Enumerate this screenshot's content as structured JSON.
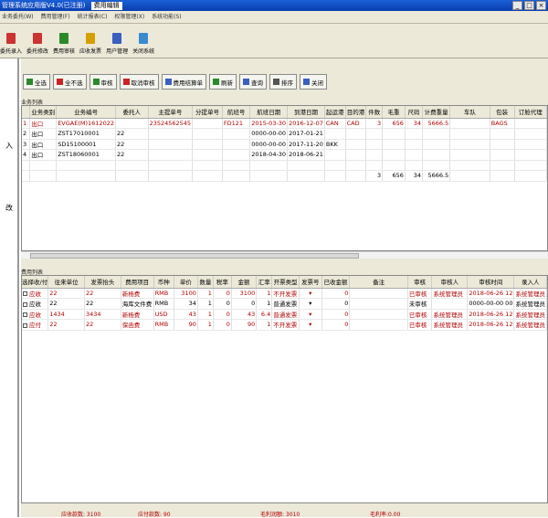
{
  "window": {
    "title": "管理系统应用版V4.0(已注册)",
    "active_tab": "费用编辑",
    "min": "_",
    "max": "□",
    "close": "×"
  },
  "menu": [
    "业务委托(W)",
    "费用管理(F)",
    "统计报表(C)",
    "权限管理(X)",
    "系统功能(S)"
  ],
  "toolbar": [
    {
      "label": "委托录入",
      "color": "#cc3333"
    },
    {
      "label": "委托修改",
      "color": "#cc3333"
    },
    {
      "label": "费用审核",
      "color": "#2a8a2a"
    },
    {
      "label": "应收发票",
      "color": "#d4a000"
    },
    {
      "label": "用户管理",
      "color": "#3a5fc0"
    },
    {
      "label": "关闭系统",
      "color": "#3a8ad0"
    }
  ],
  "left_panel": {
    "chars": [
      "入",
      "改"
    ]
  },
  "actions": [
    {
      "label": "全选",
      "color": "#2a8a2a"
    },
    {
      "label": "全不选",
      "color": "#cc2222"
    },
    {
      "label": "审核",
      "color": "#2a8a2a"
    },
    {
      "label": "取消审核",
      "color": "#cc2222"
    },
    {
      "label": "费用结算单",
      "color": "#3a5fc0"
    },
    {
      "label": "刷新",
      "color": "#2a8a2a"
    },
    {
      "label": "查询",
      "color": "#3a5fc0"
    },
    {
      "label": "排序",
      "color": "#555"
    },
    {
      "label": "关闭",
      "color": "#3a5fc0"
    }
  ],
  "business": {
    "section_title": "业务列表",
    "columns": [
      "",
      "业务类别",
      "业务编号",
      "委托人",
      "主提单号",
      "分提单号",
      "航班号",
      "航班日期",
      "到港日期",
      "起运港",
      "目的港",
      "件数",
      "毛重",
      "尺码",
      "计费重量",
      "车队",
      "包装",
      "订舱代理"
    ],
    "rows": [
      [
        "1",
        "出口",
        "EVGAE(M)1612022",
        "",
        "23524562545",
        "",
        "FD121",
        "2015-03-30",
        "2016-12-07",
        "CAN",
        "CAD",
        "3",
        "656",
        "34",
        "5666.5",
        "",
        "BAGS",
        ""
      ],
      [
        "2",
        "出口",
        "ZST17010001",
        "22",
        "",
        "",
        "",
        "0000-00-00",
        "2017-01-21",
        "",
        "",
        "",
        "",
        "",
        "",
        "",
        "",
        ""
      ],
      [
        "3",
        "出口",
        "SD15100001",
        "22",
        "",
        "",
        "",
        "0000-00-00",
        "2017-11-20",
        "BKK",
        "",
        "",
        "",
        "",
        "",
        "",
        "",
        ""
      ],
      [
        "4",
        "出口",
        "ZST18060001",
        "22",
        "",
        "",
        "",
        "2018-04-30",
        "2018-06-21",
        "",
        "",
        "",
        "",
        "",
        "",
        "",
        "",
        ""
      ]
    ],
    "totals": {
      "pieces": "3",
      "weight": "656",
      "size": "34",
      "charge": "5666.5"
    }
  },
  "fees": {
    "section_title": "费用列表",
    "columns": [
      "选择收/付",
      "往来单位",
      "发票抬头",
      "费用项目",
      "币种",
      "单价",
      "数量",
      "税率",
      "金额",
      "汇率",
      "开票类型",
      "发票号",
      "已收金额",
      "备注",
      "审核",
      "审核人",
      "审核时间",
      "录入人"
    ],
    "rows": [
      [
        "应收",
        "22",
        "22",
        "新杨费",
        "RMB",
        "3100",
        "1",
        "0",
        "3100",
        "1",
        "不开发票",
        "▾",
        "0",
        "",
        "已审核",
        "系统管理员",
        "2018-06-26 12",
        "系统管理员"
      ],
      [
        "应收",
        "22",
        "22",
        "海库文件费",
        "RMB",
        "34",
        "1",
        "0",
        "0",
        "1",
        "普通发票",
        "▾",
        "0",
        "",
        "未审核",
        "",
        "0000-00-00 00",
        "系统管理员"
      ],
      [
        "应收",
        "1434",
        "3434",
        "新杨费",
        "USD",
        "43",
        "1",
        "0",
        "43",
        "6.4",
        "普通发票",
        "▾",
        "0",
        "",
        "已审核",
        "系统管理员",
        "2018-06-26 12",
        "系统管理员"
      ],
      [
        "应付",
        "22",
        "22",
        "保函费",
        "RMB",
        "90",
        "1",
        "0",
        "90",
        "1",
        "不开发票",
        "▾",
        "0",
        "",
        "已审核",
        "系统管理员",
        "2018-06-26 12",
        "系统管理员"
      ]
    ]
  },
  "footer": {
    "recv": "应收款数: 3100",
    "pay": "应付款数: 90",
    "profit": "毛利润额: 3010",
    "other": "毛利率:0.00"
  }
}
